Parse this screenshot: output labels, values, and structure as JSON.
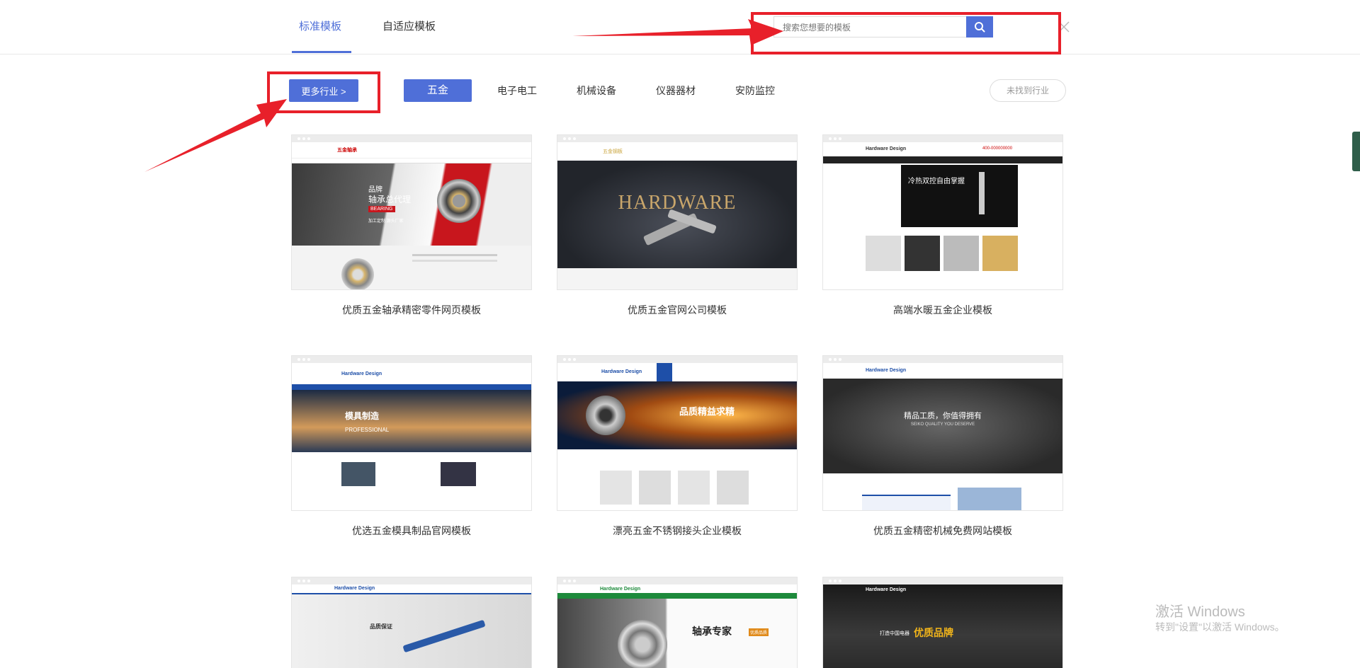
{
  "tabs": [
    {
      "label": "标准模板"
    },
    {
      "label": "自适应模板"
    }
  ],
  "search": {
    "placeholder": "搜索您想要的模板",
    "button_icon": "search-icon"
  },
  "categories": {
    "more_button": "更多行业 >",
    "items": [
      "五金",
      "电子电工",
      "机械设备",
      "仪器器材",
      "安防监控"
    ],
    "not_found": "未找到行业"
  },
  "cards": [
    {
      "title": "优质五金轴承精密零件网页模板",
      "thumb": {
        "brand": "五金轴承",
        "headline": "品牌",
        "sub": "轴承总代理",
        "tag": "BEARING",
        "foot": "加工定制  源头厂家"
      }
    },
    {
      "title": "优质五金官网公司模板",
      "thumb": {
        "brand": "五金钢板",
        "headline": "HARDWARE"
      }
    },
    {
      "title": "高端水暖五金企业模板",
      "thumb": {
        "brand": "Hardware Design",
        "headline": "冷热双控自由掌握",
        "phone": "400-000000000"
      }
    },
    {
      "title": "优选五金模具制品官网模板",
      "thumb": {
        "brand": "Hardware Design",
        "headline": "模具制造",
        "sub": "PROFESSIONAL"
      }
    },
    {
      "title": "漂亮五金不锈钢接头企业模板",
      "thumb": {
        "brand": "Hardware Design",
        "headline": "品质精益求精"
      }
    },
    {
      "title": "优质五金精密机械免费网站模板",
      "thumb": {
        "brand": "Hardware Design",
        "headline": "精品工质，你值得拥有",
        "sub": "SEIKO QUALITY YOU DESERVE"
      }
    },
    {
      "title": "",
      "thumb": {
        "brand": "Hardware Design",
        "headline": "品质保证"
      }
    },
    {
      "title": "",
      "thumb": {
        "brand": "Hardware Design",
        "headline": "轴承专家",
        "sub": "优质品质"
      }
    },
    {
      "title": "",
      "thumb": {
        "brand": "Hardware Design",
        "headline": "优质品牌",
        "sub": "打造中国电器"
      }
    }
  ],
  "watermark": {
    "line1": "激活 Windows",
    "line2": "转到\"设置\"以激活 Windows。"
  },
  "colors": {
    "accent": "#4f6fd8",
    "annotation_red": "#e8202a"
  }
}
